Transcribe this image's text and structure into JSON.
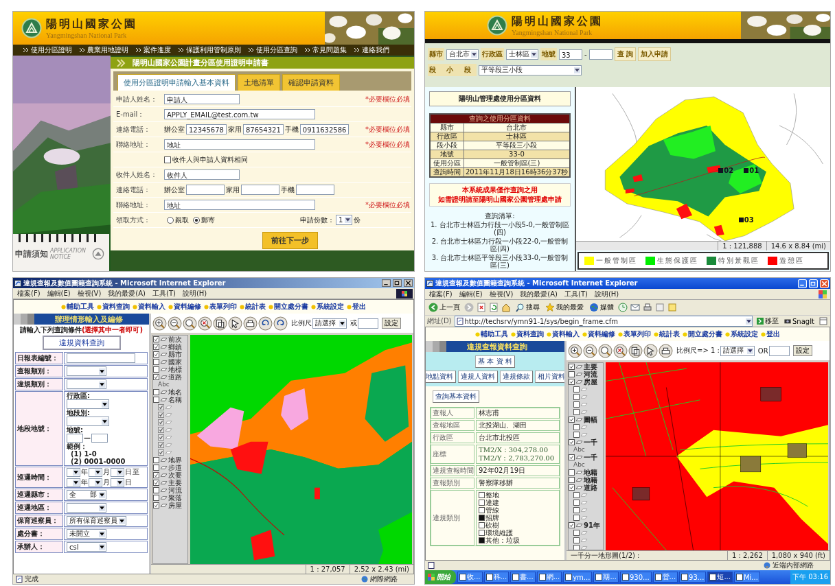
{
  "apply_form": {
    "header": {
      "title": "陽明山國家公園",
      "subtitle": "Yangmingshan National Park"
    },
    "nav": [
      "使用分區證明",
      "農業用地證明",
      "案件進度",
      "保護利用管制原則",
      "使用分區查詢",
      "常見問題集",
      "連絡我們"
    ],
    "title": "陽明山國家公園計畫分區使用證明申請書",
    "tabs": [
      {
        "label": "使用分區證明申請輸入基本資料",
        "selected": true
      },
      {
        "label": "土地清單",
        "selected": false
      },
      {
        "label": "確認申請資料",
        "selected": false
      }
    ],
    "rows": [
      {
        "kind": "short",
        "label": "申請人姓名：",
        "value": "申請人",
        "note": "*必要欄位必填"
      },
      {
        "kind": "long",
        "label": "E-mail：",
        "value": "APPLY_EMAIL@test.com.tw"
      },
      {
        "kind": "phone",
        "label": "連絡電話：",
        "parts": [
          {
            "label": "辦公室",
            "value": "12345678"
          },
          {
            "label": "家用",
            "value": "87654321"
          },
          {
            "label": "手機",
            "value": "0911632586"
          }
        ],
        "note": "*必要欄位必填"
      },
      {
        "kind": "long",
        "label": "聯絡地址：",
        "value": "地址",
        "note": "*必要欄位必填"
      },
      {
        "kind": "check",
        "label": "收件人與申請人資料相同",
        "checked": false
      },
      {
        "kind": "short",
        "label": "收件人姓名：",
        "value": "收件人"
      },
      {
        "kind": "phone",
        "label": "連絡電話：",
        "parts": [
          {
            "label": "辦公室"
          },
          {
            "label": "家用"
          },
          {
            "label": "手機"
          }
        ]
      },
      {
        "kind": "long",
        "label": "聯絡地址：",
        "value": "地址",
        "note": "*必要欄位必填"
      },
      {
        "kind": "radio",
        "label": "領取方式：",
        "options": [
          {
            "label": "親取",
            "selected": false
          },
          {
            "label": "郵寄",
            "selected": true
          }
        ],
        "copies_label": "申請份數：",
        "copies": "1",
        "unit": "份"
      }
    ],
    "next_button": "前往下一步",
    "notice": {
      "title": "申請須知",
      "subtitle": "APPLICATION NOTICE"
    }
  },
  "zone_query": {
    "header": {
      "title": "陽明山國家公園",
      "subtitle": "Yangmingshan National Park"
    },
    "filters": {
      "county_label": "縣市",
      "county": "台北市",
      "district_label": "行政區",
      "district": "士林區",
      "lot_label": "地號",
      "lot": "33",
      "lot_sep": "-",
      "section_label": "段 小 段",
      "section": "平等段三小段"
    },
    "buttons": [
      "查 詢",
      "加入申請"
    ],
    "info_title": "陽明山管理處使用分區資料",
    "result_caption": "查詢之使用分區資料",
    "result": [
      {
        "label": "縣市",
        "value": "台北市"
      },
      {
        "label": "行政區",
        "value": "士林區"
      },
      {
        "label": "段小段",
        "value": "平等段三小段"
      },
      {
        "label": "地號",
        "value": "33-0"
      },
      {
        "label": "使用分區",
        "value": "一般管制區(三)"
      },
      {
        "label": "查詢時間",
        "value": "2011年11月18日16時36分37秒"
      }
    ],
    "warning": [
      "本系統成果僅作查詢之用",
      "如需證明請至陽明山國家公園管理處申請"
    ],
    "list_title": "查詢清單:",
    "list": [
      "1. 台北市士林區力行段一小段5-0,一般管制區(四)",
      "2. 台北市士林區力行段一小段22-0,一般管制區(四)",
      "3. 台北市士林區平等段三小段33-0,一般管制區(三)"
    ],
    "markers": [
      "02",
      "01",
      "03"
    ],
    "map_status": [
      "1 : 121,888",
      "14.6 x 8.84 (mi)"
    ],
    "legend": [
      {
        "label": "一般管制區",
        "color": "#ffff00"
      },
      {
        "label": "生態保護區",
        "color": "#00ee00"
      },
      {
        "label": "特別景觀區",
        "color": "#1a8a3a"
      },
      {
        "label": "遊憩區",
        "color": "#ff0000"
      }
    ]
  },
  "report_editor": {
    "window_title": "違規查報及數值圖籍查詢系統 - Microsoft Internet Explorer",
    "menu": [
      "檔案(F)",
      "編輯(E)",
      "檢視(V)",
      "我的最愛(A)",
      "工具(T)",
      "說明(H)"
    ],
    "nav": [
      "輔助工具",
      "資料查詢",
      "資料輸入",
      "資料編修",
      "表單列印",
      "統計表",
      "開立處分書",
      "系統設定",
      "登出"
    ],
    "section_title": "辦理情形輸入及編修",
    "prompt": "請輸入下列查詢條件",
    "prompt_hint": "(選擇其中一者即可)",
    "query_button": "違規資料查詢",
    "rows": [
      {
        "kind": "input",
        "label": "日報表編號："
      },
      {
        "kind": "select",
        "label": "查報類別："
      },
      {
        "kind": "select",
        "label": "違規類別："
      },
      {
        "kind": "parcel",
        "label": "地段地號：",
        "district_label": "行政區:",
        "section_label": "地段別:",
        "lot_label": "地號:",
        "lot_sep": "—",
        "example_label": "範例：",
        "examples": [
          "(1) 1-0",
          "(2) 0001-0000"
        ]
      },
      {
        "kind": "dates",
        "label": "巡邏時間：",
        "lines": [
          [
            "年",
            "月",
            "日",
            "至"
          ],
          [
            "年",
            "月",
            "日"
          ]
        ]
      },
      {
        "kind": "select",
        "label": "巡邏縣市：",
        "value": "全　　部"
      },
      {
        "kind": "select",
        "label": "巡邏地區："
      },
      {
        "kind": "select",
        "label": "保育巡察員：",
        "value": "所有保育巡察員"
      },
      {
        "kind": "select",
        "label": "處分書：",
        "value": "未開立"
      },
      {
        "kind": "select",
        "label": "承辦人：",
        "value": "csl"
      }
    ],
    "scale_label": "比例尺",
    "scale_value": "請選擇",
    "or_label": "或",
    "set_button": "設定",
    "layers": [
      {
        "label": "前次",
        "checked": true
      },
      {
        "label": "鄉鎮",
        "checked": true
      },
      {
        "label": "縣市",
        "checked": true
      },
      {
        "label": "國家",
        "checked": false
      },
      {
        "label": "地標",
        "checked": false
      },
      {
        "label": "道路",
        "checked": true,
        "sample": "Abc"
      },
      {
        "label": "地名",
        "checked": false
      },
      {
        "label": "名稱",
        "checked": false,
        "children": [
          {
            "checked": true,
            "disabled": true
          },
          {
            "checked": true,
            "disabled": true
          },
          {
            "checked": true,
            "disabled": true
          },
          {
            "checked": true,
            "disabled": true
          },
          {
            "checked": true,
            "disabled": true
          },
          {
            "checked": true,
            "disabled": true
          },
          {
            "checked": true,
            "disabled": true
          }
        ]
      },
      {
        "label": "地界",
        "checked": false
      },
      {
        "label": "步道",
        "checked": false
      },
      {
        "label": "次要",
        "checked": true
      },
      {
        "label": "主要",
        "checked": true
      },
      {
        "label": "河流",
        "checked": false
      },
      {
        "label": "聚落",
        "checked": false
      },
      {
        "label": "房屋",
        "checked": true
      }
    ],
    "map_status": [
      "1 : 27,057",
      "2.52 x 2.43 (mi)"
    ],
    "status": "完成",
    "zone": "網際網路"
  },
  "violation_query": {
    "window_title": "違規查報及數值圖籍查詢系統 - Microsoft Internet Explorer",
    "menu": [
      "檔案(F)",
      "編輯(E)",
      "檢視(V)",
      "我的最愛(A)",
      "工具(T)",
      "說明(H)"
    ],
    "toolbar": {
      "back": "上一頁",
      "search": "搜尋",
      "favorites": "我的最愛",
      "media": "媒體"
    },
    "address": {
      "label": "網址(D)",
      "url": "http://techsrv/ymn91-1/sys/begin_frame.cfm",
      "go": "移至",
      "snagit": "SnagIt"
    },
    "nav": [
      "輔助工具",
      "資料查詢",
      "資料輸入",
      "資料編修",
      "表單列印",
      "統計表",
      "開立處分書",
      "系統設定",
      "登出"
    ],
    "section_title": "違規查報資料查詢",
    "basic_button": "基 本 資 料",
    "tabs": [
      "地點資料",
      "違規人資料",
      "違規條款",
      "相片資料"
    ],
    "query_button": "查詢基本資料",
    "rows": [
      {
        "kind": "text",
        "label": "查報人",
        "value": "林志甫"
      },
      {
        "kind": "text",
        "label": "查報地區",
        "value": "北投湖山、湖田"
      },
      {
        "kind": "text",
        "label": "行政區",
        "value": "台北市北投區"
      },
      {
        "kind": "lines",
        "label": "座標",
        "lines": [
          "TM2/X：304,278.00",
          "TM2/Y：2,783,270.00"
        ]
      },
      {
        "kind": "text",
        "label": "違規查報時間",
        "value": "92年02月19日"
      },
      {
        "kind": "text",
        "label": "查報類別",
        "value": "警察隊移辦"
      },
      {
        "kind": "checks",
        "label": "違規類別",
        "items": [
          {
            "label": "整地",
            "checked": false
          },
          {
            "label": "違建",
            "checked": false
          },
          {
            "label": "管線",
            "checked": false
          },
          {
            "label": "招牌",
            "checked": true
          },
          {
            "label": "砍樹",
            "checked": false
          },
          {
            "label": "環境維護",
            "checked": false
          },
          {
            "label": "其他：垃圾",
            "checked": true
          }
        ]
      }
    ],
    "scale_label": "比例尺=> 1 :",
    "scale_value": "請選擇",
    "or_label": "OR",
    "set_button": "設定",
    "layers": [
      {
        "label": "主要",
        "checked": true
      },
      {
        "label": "河流",
        "checked": false
      },
      {
        "label": "房屋",
        "checked": true,
        "children": [
          {
            "checked": false,
            "disabled": false
          },
          {
            "checked": false,
            "disabled": false
          },
          {
            "checked": false,
            "disabled": false
          },
          {
            "checked": false,
            "disabled": false
          }
        ]
      },
      {
        "label": "圖幅",
        "checked": true,
        "children": [
          {
            "checked": false,
            "disabled": false
          },
          {
            "checked": false,
            "disabled": false
          }
        ]
      },
      {
        "label": "一千",
        "checked": true,
        "sample": "Abc"
      },
      {
        "label": "一千",
        "checked": true,
        "sample": "Abc"
      },
      {
        "label": "地籍",
        "checked": false
      },
      {
        "label": "地籍",
        "checked": false
      },
      {
        "label": "道路",
        "checked": true,
        "children": [
          {
            "checked": false,
            "disabled": false
          },
          {
            "checked": false,
            "disabled": false
          },
          {
            "checked": false,
            "disabled": false
          },
          {
            "checked": false,
            "disabled": false
          }
        ]
      },
      {
        "label": "91年",
        "checked": true,
        "children": [
          {
            "checked": false,
            "disabled": false
          },
          {
            "checked": false,
            "disabled": false
          },
          {
            "checked": false,
            "disabled": false
          }
        ]
      }
    ],
    "map_status": [
      "一千分一地形圖(1/2) :",
      "1 : 2,262",
      "1,080 x 940 (ft)"
    ],
    "zone": "近端內部網路",
    "taskbar": {
      "start": "開始",
      "items": [
        {
          "label": "收...",
          "selected": false
        },
        {
          "label": "科...",
          "selected": false
        },
        {
          "label": "書...",
          "selected": false
        },
        {
          "label": "網...",
          "selected": false
        },
        {
          "label": "ym...",
          "selected": false
        },
        {
          "label": "期...",
          "selected": false
        },
        {
          "label": "930...",
          "selected": false
        },
        {
          "label": "營...",
          "selected": false
        },
        {
          "label": "93...",
          "selected": false
        },
        {
          "label": "短...",
          "selected": true
        },
        {
          "label": "Mi...",
          "selected": false
        }
      ],
      "clock": "下午 03:16"
    }
  }
}
